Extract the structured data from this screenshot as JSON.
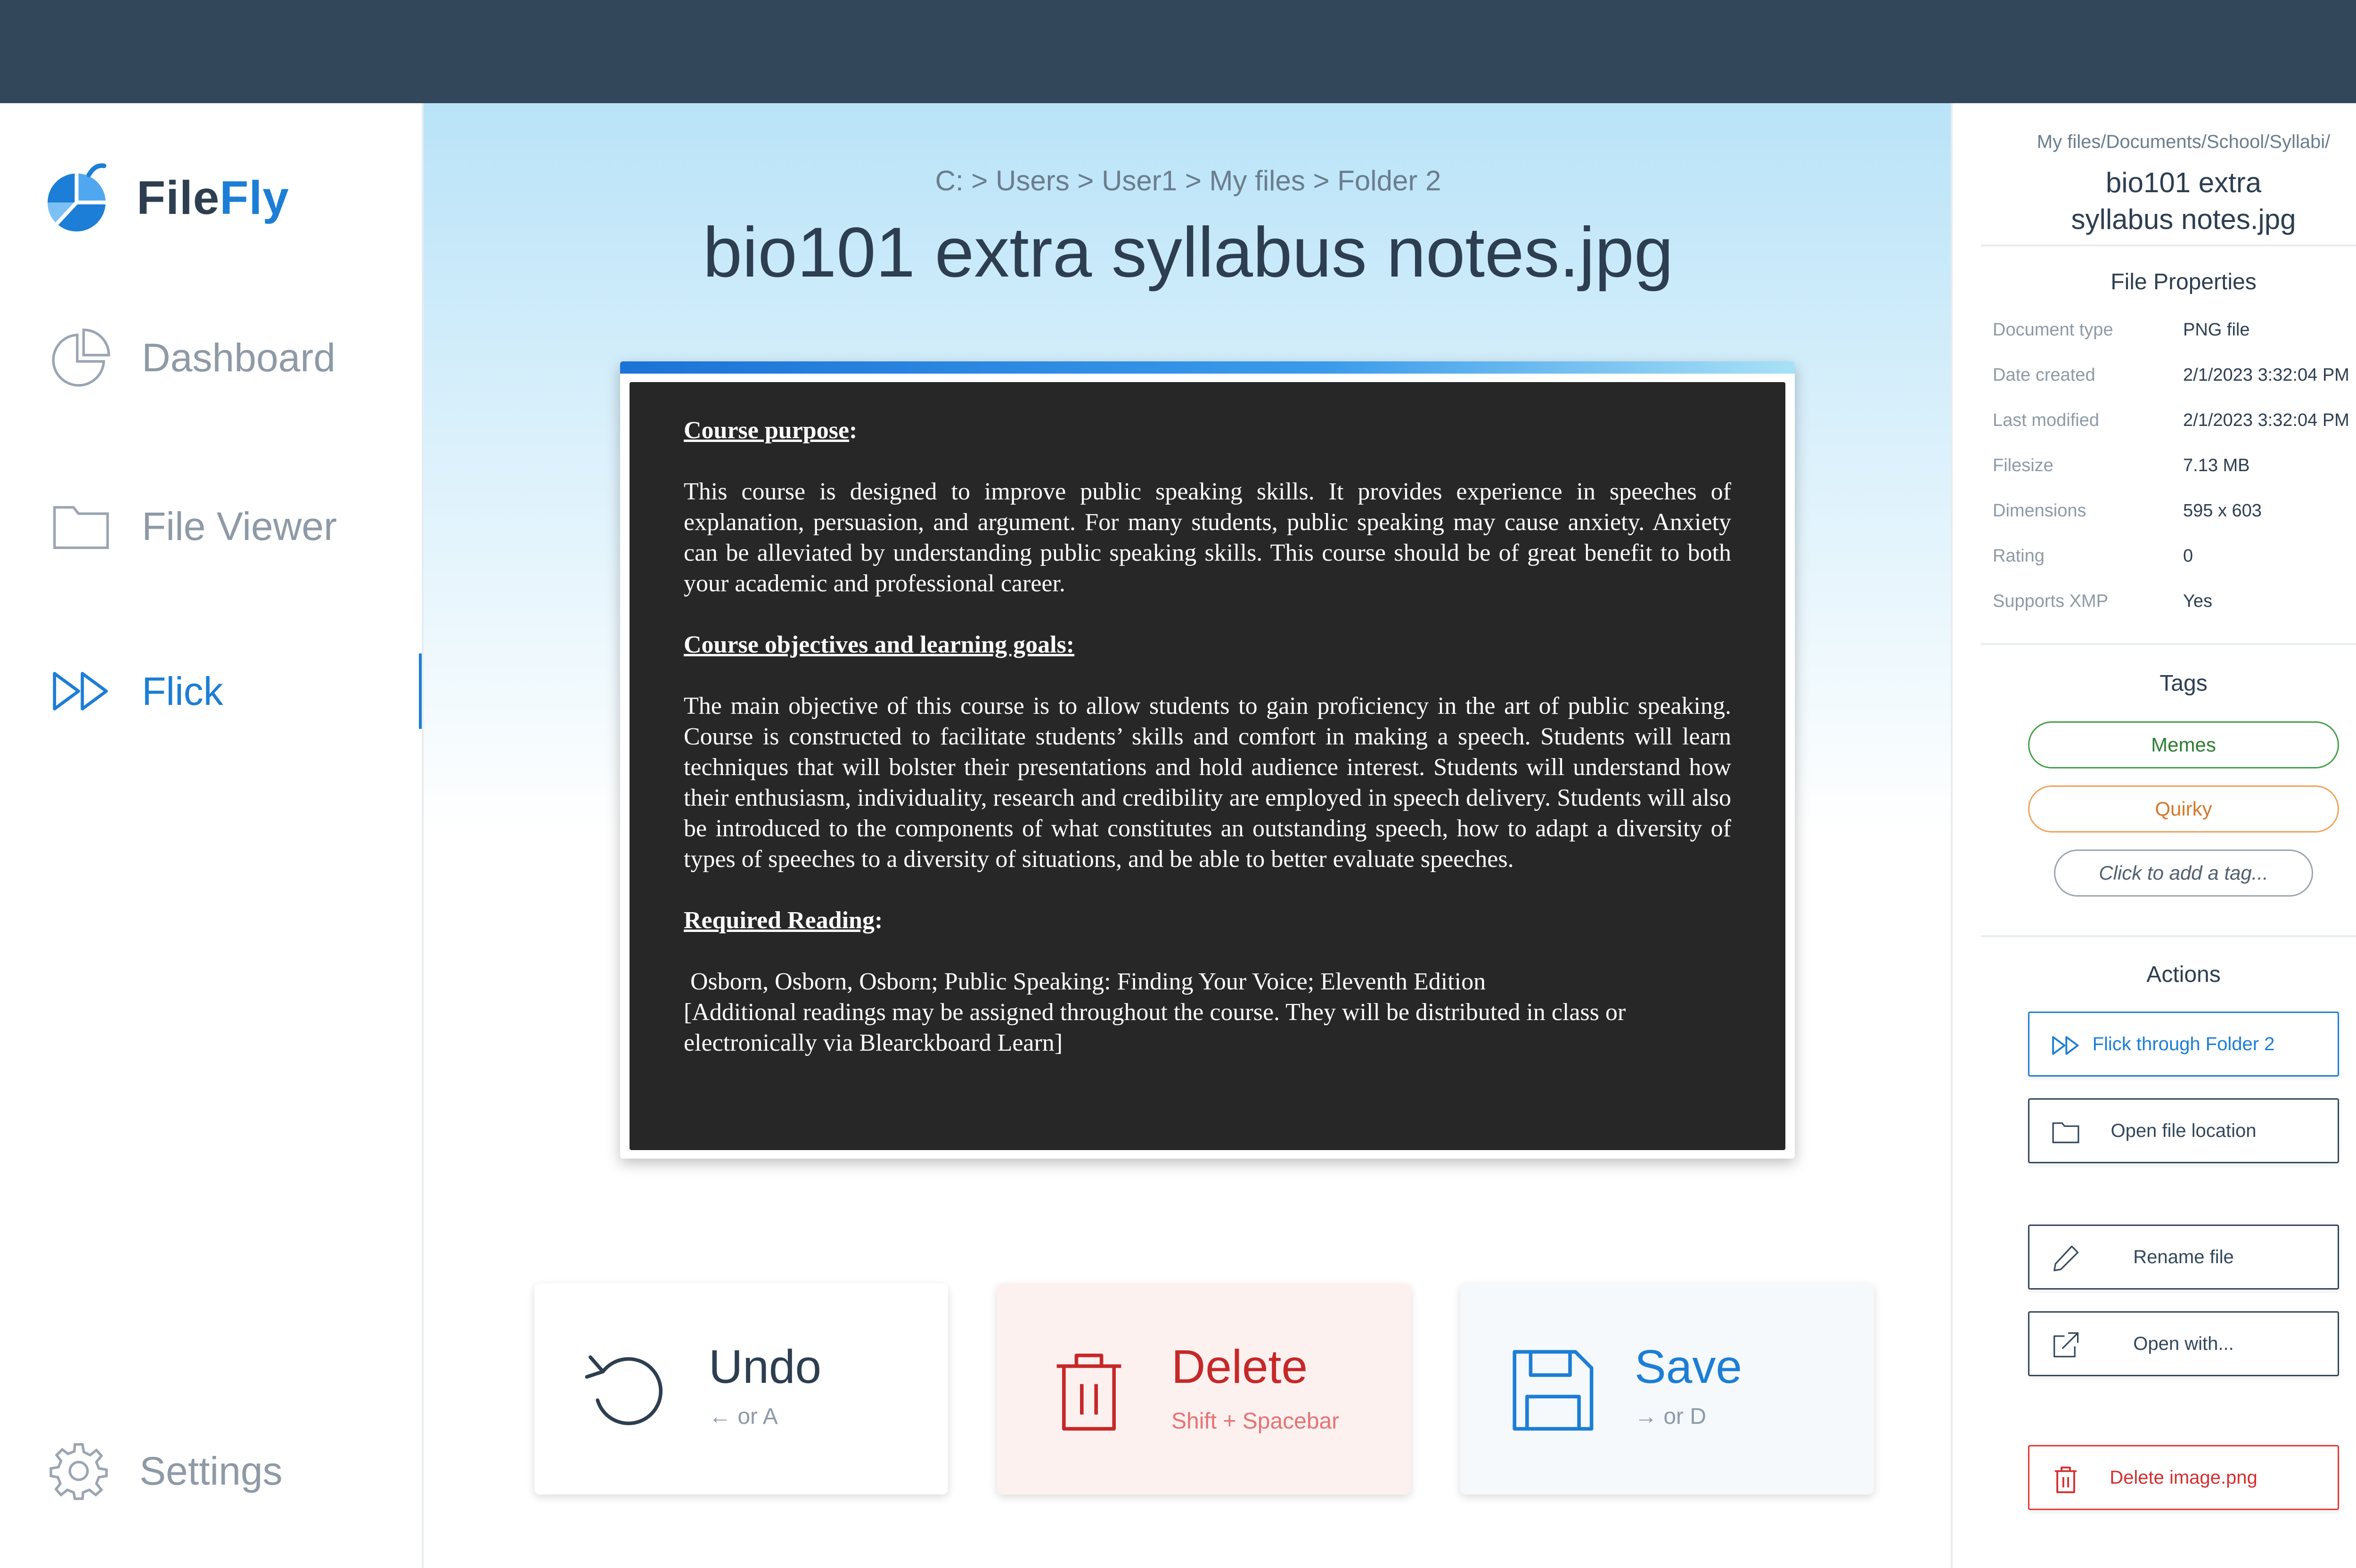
{
  "app": {
    "name_part1": "File",
    "name_part2": "Fly"
  },
  "sidebar": {
    "items": [
      {
        "label": "Dashboard",
        "icon": "pie-chart-icon"
      },
      {
        "label": "File Viewer",
        "icon": "folder-icon"
      },
      {
        "label": "Flick",
        "icon": "fast-forward-icon",
        "active": true
      }
    ],
    "settings": {
      "label": "Settings",
      "icon": "gear-icon"
    }
  },
  "main": {
    "breadcrumb": "C: > Users > User1 > My files > Folder 2",
    "title": "bio101 extra syllabus notes.jpg",
    "document": {
      "heading1": "Course purpose",
      "heading1_suffix": ":",
      "para1": "This course is designed to improve public speaking skills. It provides experience in speeches of explanation, persuasion, and argument. For many students, public speaking may cause anxiety. Anxiety can be alleviated by understanding public speaking skills. This course should be of great benefit to both your academic and professional career.",
      "heading2": "Course objectives and learning goals:",
      "para2": "The main objective of this course is to allow students to gain proficiency in the art of public speaking. Course is constructed to facilitate students’ skills and comfort in making a speech. Students will learn techniques that will bolster their presentations and hold audience interest. Students will understand how their enthusiasm, individuality, research and credibility are employed in speech delivery. Students will also be introduced to the components of what constitutes an outstanding speech, how to adapt a diversity of types of speeches to a diversity of situations, and be able to better evaluate speeches.",
      "heading3": "Required Reading",
      "heading3_suffix": ":",
      "para3a": "Osborn, Osborn, Osborn; Public Speaking: Finding Your Voice; Eleventh Edition",
      "para3b": "[Additional readings may be assigned throughout the course. They will be distributed in class or electronically via Blearckboard Learn]"
    },
    "actions": {
      "undo": {
        "label": "Undo",
        "hint": "← or A"
      },
      "delete": {
        "label": "Delete",
        "hint": "Shift + Spacebar"
      },
      "save": {
        "label": "Save",
        "hint": "→ or D"
      }
    }
  },
  "panel": {
    "path": "My files/Documents/School/Syllabi/",
    "file_line1": "bio101 extra",
    "file_line2": "syllabus notes.jpg",
    "properties_title": "File Properties",
    "properties": [
      {
        "label": "Document type",
        "value": "PNG file"
      },
      {
        "label": "Date created",
        "value": "2/1/2023 3:32:04 PM"
      },
      {
        "label": "Last modified",
        "value": "2/1/2023 3:32:04 PM"
      },
      {
        "label": "Filesize",
        "value": "7.13 MB"
      },
      {
        "label": "Dimensions",
        "value": "595 x 603"
      },
      {
        "label": "Rating",
        "value": "0"
      },
      {
        "label": "Supports XMP",
        "value": "Yes"
      }
    ],
    "tags_title": "Tags",
    "tags": [
      {
        "label": "Memes",
        "color": "#43a047"
      },
      {
        "label": "Quirky",
        "color": "#f0a35c"
      }
    ],
    "add_tag": "Click to add a tag...",
    "actions_title": "Actions",
    "actions": {
      "flick": "Flick through Folder 2",
      "open_location": "Open file location",
      "rename": "Rename file",
      "open_with": "Open with...",
      "delete": "Delete image.png"
    }
  },
  "colors": {
    "accent": "#1c7ed6",
    "topbar": "#33475b",
    "danger": "#c62828"
  }
}
